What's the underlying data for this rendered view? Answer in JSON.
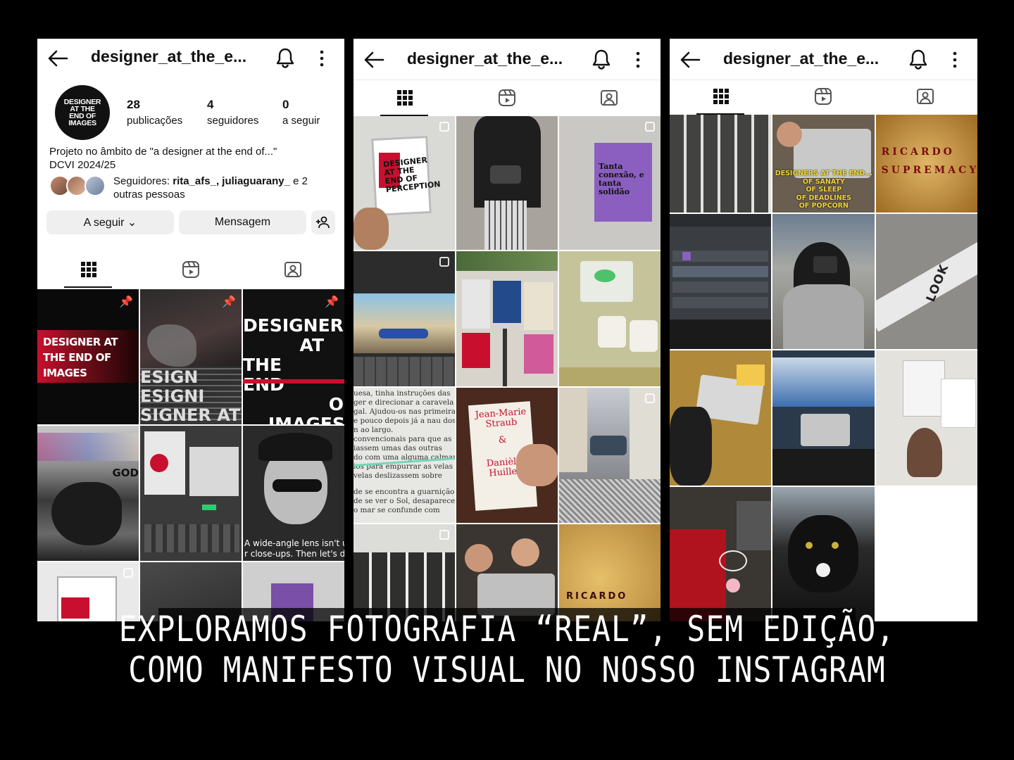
{
  "profile": {
    "username": "designer_at_the_e...",
    "avatar_text": "DESIGNER AT THE END OF IMAGES",
    "stats": [
      {
        "num": "28",
        "label": "publicações"
      },
      {
        "num": "4",
        "label": "seguidores"
      },
      {
        "num": "0",
        "label": "a seguir"
      }
    ],
    "bio_line1": "Projeto no âmbito de \"a designer at the end of...\"",
    "bio_line2": "DCVI 2024/25",
    "followers_prefix": "Seguidores: ",
    "followers_names": "rita_afs_, juliaguarany_",
    "followers_suffix": " e 2",
    "followers_line2": "outras pessoas",
    "btn_following": "A seguir ⌄",
    "btn_message": "Mensagem"
  },
  "tiles": {
    "t1": "DESIGNER AT THE END OF IMAGES",
    "t3_lines": [
      "DESIGNER",
      "AT",
      "THE",
      "END",
      "O",
      "IMAGES"
    ],
    "t4": "GOD",
    "t6_line1": "A wide-angle lens isn't use",
    "t6_line2": "r close-ups. Then let's do",
    "p2_t1": "DESIGNER AT THE END OF PERCEPTION",
    "p2_t3": "Tanta conexão, e tanta solidão",
    "p2_t7_lines": [
      "uesa, tinha instruções das",
      "ger e direcionar a caravela",
      "gal. Ajudou-os nas primeiras",
      "e pouco depois já a nau dos",
      "n ao largo.",
      "convencionais para que as",
      "iassem umas das outras",
      "do com uma alguma calmaria,",
      "ios para empurrar as velas",
      "velas deslizassem sobre",
      "de se encontra a guarnição da",
      "de se ver o Sol, desaparecen",
      "o mar se confunde com"
    ],
    "p2_t8_author1": "Jean-Marie Straub",
    "p2_t8_amp": "&",
    "p2_t8_author2": "Danièle Huillet",
    "p2_t12": "RICARDO",
    "p3_t2_lines": [
      "DESIGNERS AT THE END...",
      "OF SANATY",
      "OF SLEEP",
      "OF DEADLINES",
      "OF POPCORN"
    ],
    "p3_t3_lines": [
      "RICARDO",
      "SUPREMACY"
    ],
    "p3_t6": "LOOK"
  },
  "caption": {
    "line1": "EXPLORAMOS FOTOGRAFIA “REAL”, SEM EDIÇÃO,",
    "line2": "COMO MANIFESTO VISUAL NO NOSSO INSTAGRAM"
  }
}
